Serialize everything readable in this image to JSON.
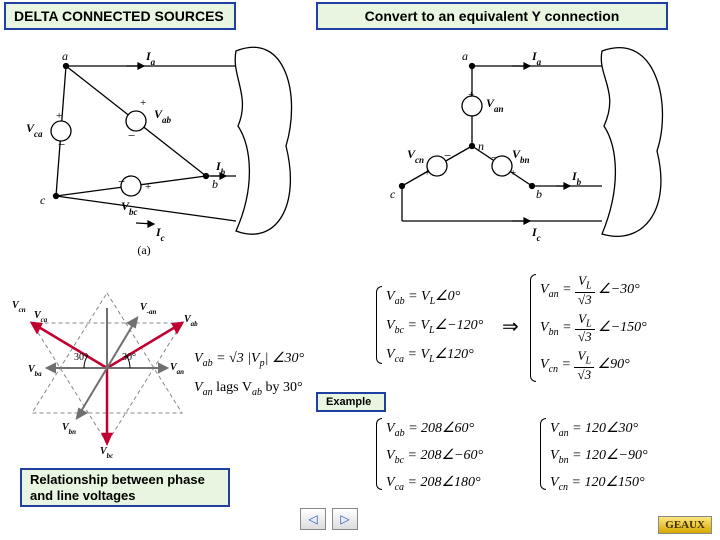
{
  "titles": {
    "left": "DELTA CONNECTED SOURCES",
    "right": "Convert to an equivalent Y connection"
  },
  "labels": {
    "example": "Example",
    "relation": "Relationship between phase and line voltages"
  },
  "delta_diagram": {
    "nodes": {
      "a": "a",
      "b": "b",
      "c": "c"
    },
    "currents": {
      "Ia": "I",
      "Ib": "I",
      "Ic": "I"
    },
    "voltages": {
      "Vab": "V",
      "Vbc": "V",
      "Vca": "V"
    },
    "caption": "(a)"
  },
  "y_diagram": {
    "nodes": {
      "a": "a",
      "b": "b",
      "c": "c",
      "n": "n"
    },
    "currents": {
      "Ia": "I",
      "Ib": "I",
      "Ic": "I"
    },
    "voltages": {
      "Van": "V",
      "Vbn": "V",
      "Vcn": "V"
    }
  },
  "phasor": {
    "labels": [
      "V",
      "V",
      "V",
      "V",
      "V",
      "V",
      "V",
      "V"
    ],
    "sublabels": [
      "cn",
      "ca",
      "an",
      "ab",
      "bn",
      "bc",
      "ba",
      "-an"
    ],
    "angle": "30°"
  },
  "relation_eq": {
    "line1_lhs": "V",
    "line1_sub": "ab",
    "line1_rhs": " = √3 |V",
    "line1_sub2": "p",
    "line1_tail": "| ∠30°",
    "line2": "V",
    "line2_sub1": "an",
    "line2_mid": " lags V",
    "line2_sub2": "ab",
    "line2_tail": " by 30°"
  },
  "line_voltages": {
    "rows": [
      {
        "lhs": "V",
        "sub": "ab",
        "rhs": "= V",
        "rsub": "L",
        "ang": "∠0°"
      },
      {
        "lhs": "V",
        "sub": "bc",
        "rhs": "= V",
        "rsub": "L",
        "ang": "∠−120°"
      },
      {
        "lhs": "V",
        "sub": "ca",
        "rhs": "= V",
        "rsub": "L",
        "ang": "∠120°"
      }
    ]
  },
  "phase_voltages": {
    "rows": [
      {
        "lhs": "V",
        "sub": "an",
        "num": "V",
        "numsub": "L",
        "den": "√3",
        "ang": "∠−30°"
      },
      {
        "lhs": "V",
        "sub": "bn",
        "num": "V",
        "numsub": "L",
        "den": "√3",
        "ang": "∠−150°"
      },
      {
        "lhs": "V",
        "sub": "cn",
        "num": "V",
        "numsub": "L",
        "den": "√3",
        "ang": "∠90°"
      }
    ]
  },
  "example_line": {
    "rows": [
      {
        "lhs": "V",
        "sub": "ab",
        "rhs": "= 208∠60°"
      },
      {
        "lhs": "V",
        "sub": "bc",
        "rhs": "= 208∠−60°"
      },
      {
        "lhs": "V",
        "sub": "ca",
        "rhs": "= 208∠180°"
      }
    ]
  },
  "example_phase": {
    "rows": [
      {
        "lhs": "V",
        "sub": "an",
        "rhs": "= 120∠30°"
      },
      {
        "lhs": "V",
        "sub": "bn",
        "rhs": "= 120∠−90°"
      },
      {
        "lhs": "V",
        "sub": "cn",
        "rhs": "= 120∠150°"
      }
    ]
  },
  "nav": {
    "prev": "◁",
    "next": "▷"
  },
  "brand": "GEAUX",
  "chart_data": {
    "type": "table",
    "title": "Delta–Y source conversion relationships",
    "line_voltages": [
      {
        "name": "Vab",
        "magnitude": "VL",
        "angle_deg": 0
      },
      {
        "name": "Vbc",
        "magnitude": "VL",
        "angle_deg": -120
      },
      {
        "name": "Vca",
        "magnitude": "VL",
        "angle_deg": 120
      }
    ],
    "phase_voltages": [
      {
        "name": "Van",
        "magnitude": "VL/√3",
        "angle_deg": -30
      },
      {
        "name": "Vbn",
        "magnitude": "VL/√3",
        "angle_deg": -150
      },
      {
        "name": "Vcn",
        "magnitude": "VL/√3",
        "angle_deg": 90
      }
    ],
    "identity": "Vab = √3·|Vp| ∠30° ; Van lags Vab by 30°",
    "example": {
      "line": [
        {
          "name": "Vab",
          "magnitude": 208,
          "angle_deg": 60
        },
        {
          "name": "Vbc",
          "magnitude": 208,
          "angle_deg": -60
        },
        {
          "name": "Vca",
          "magnitude": 208,
          "angle_deg": 180
        }
      ],
      "phase": [
        {
          "name": "Van",
          "magnitude": 120,
          "angle_deg": 30
        },
        {
          "name": "Vbn",
          "magnitude": 120,
          "angle_deg": -90
        },
        {
          "name": "Vcn",
          "magnitude": 120,
          "angle_deg": 150
        }
      ]
    },
    "phasor_diagram": {
      "angle_between_line_and_phase_deg": 30
    }
  }
}
